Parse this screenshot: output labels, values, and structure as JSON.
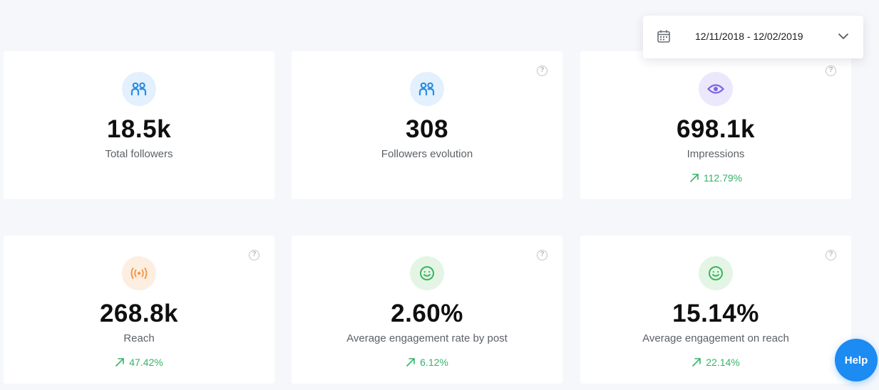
{
  "date_range": {
    "label": "12/11/2018 - 12/02/2019"
  },
  "help_button": {
    "label": "Help"
  },
  "cards": [
    {
      "id": "total-followers",
      "icon": "people-icon",
      "value": "18.5k",
      "label": "Total followers",
      "trend": ""
    },
    {
      "id": "followers-evolution",
      "icon": "people-icon",
      "value": "308",
      "label": "Followers evolution",
      "trend": ""
    },
    {
      "id": "impressions",
      "icon": "eye-icon",
      "value": "698.1k",
      "label": "Impressions",
      "trend": "112.79%"
    },
    {
      "id": "reach",
      "icon": "broadcast-icon",
      "value": "268.8k",
      "label": "Reach",
      "trend": "47.42%"
    },
    {
      "id": "avg-engagement-post",
      "icon": "smile-icon",
      "value": "2.60%",
      "label": "Average engagement rate by post",
      "trend": "6.12%"
    },
    {
      "id": "avg-engagement-reach",
      "icon": "smile-icon",
      "value": "15.14%",
      "label": "Average engagement on reach",
      "trend": "22.14%"
    }
  ],
  "colors": {
    "accent_blue": "#1c8bf2",
    "trend_green": "#35b36a",
    "icon_blue": "#2b8de3",
    "icon_purple": "#7c63e6",
    "icon_orange": "#f29a4a",
    "icon_green": "#3cb55a"
  }
}
